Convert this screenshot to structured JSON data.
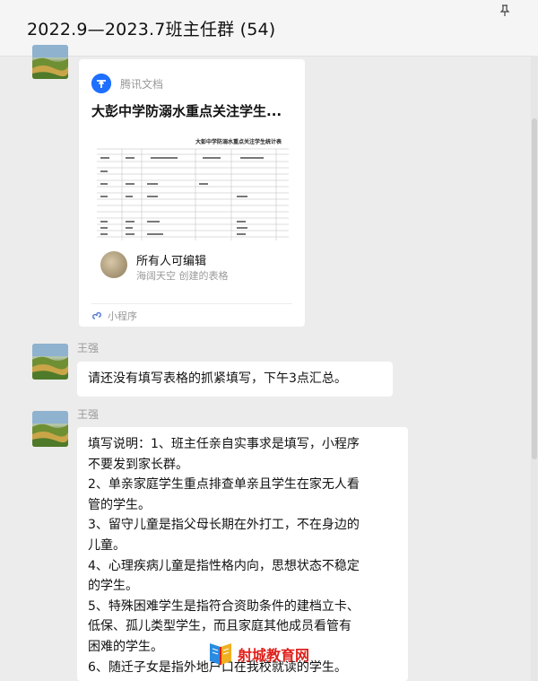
{
  "window": {
    "title": "2022.9—2023.7班主任群 (54)",
    "pin_icon": "pin-icon"
  },
  "card": {
    "source_name": "腾讯文档",
    "source_icon": "tencent-docs-logo",
    "title": "大彭中学防溺水重点关注学生...",
    "preview_title": "大彭中学防溺水重点关注学生统计表",
    "permission": "所有人可编辑",
    "creator": "海阔天空 创建的表格",
    "footer": "小程序",
    "footer_icon": "mini-program-icon"
  },
  "messages": [
    {
      "sender": "王强",
      "text": "请还没有填写表格的抓紧填写，下午3点汇总。"
    },
    {
      "sender": "王强",
      "lines": [
        "填写说明：1、班主任亲自实事求是填写，小程序",
        "不要发到家长群。",
        "2、单亲家庭学生重点排查单亲且学生在家无人看",
        "管的学生。",
        "3、留守儿童是指父母长期在外打工，不在身边的",
        "儿童。",
        "4、心理疾病儿童是指性格内向，思想状态不稳定",
        "的学生。",
        "5、特殊困难学生是指符合资助条件的建档立卡、",
        "低保、孤儿类型学生，而且家庭其他成员看管有",
        "困难的学生。",
        "6、随迁子女是指外地户口在我校就读的学生。"
      ]
    }
  ],
  "watermark": {
    "text": "射城教育网"
  }
}
